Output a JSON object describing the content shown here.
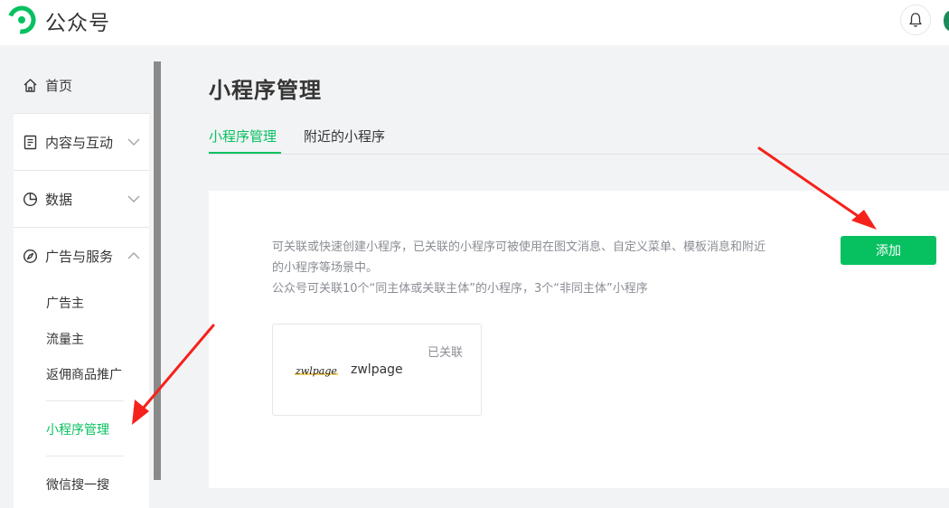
{
  "header": {
    "brand": "公众号"
  },
  "sidebar": {
    "items": [
      {
        "label": "首页",
        "icon": "home-icon"
      },
      {
        "label": "内容与互动",
        "icon": "document-icon"
      },
      {
        "label": "数据",
        "icon": "pie-chart-icon"
      },
      {
        "label": "广告与服务",
        "icon": "compass-icon"
      }
    ],
    "sub_items": [
      "广告主",
      "流量主",
      "返佣商品推广",
      "小程序管理",
      "微信搜一搜"
    ]
  },
  "main": {
    "title": "小程序管理",
    "tabs": [
      {
        "label": "小程序管理",
        "active": true
      },
      {
        "label": "附近的小程序",
        "active": false
      }
    ],
    "desc_line1": "可关联或快速创建小程序，已关联的小程序可被使用在图文消息、自定义菜单、模板消息和附近",
    "desc_line2": "的小程序等场景中。",
    "desc_line3": "公众号可关联10个“同主体或关联主体”的小程序，3个“非同主体”小程序",
    "add_button": "添加",
    "mini_program": {
      "status": "已关联",
      "logo_text": "zwlpage",
      "name": "zwlpage"
    }
  },
  "colors": {
    "accent": "#07c160",
    "annotation_arrow": "#f5221b"
  }
}
